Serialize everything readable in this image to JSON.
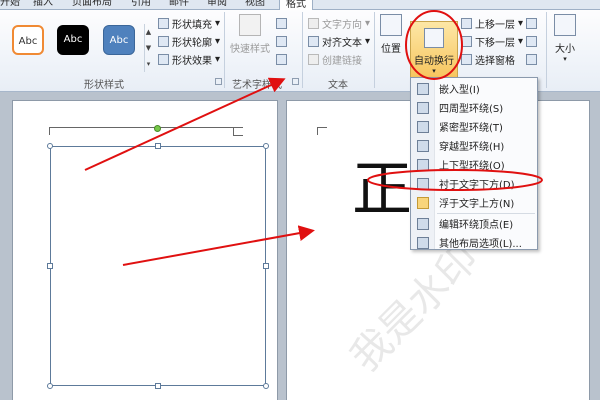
{
  "tabs": [
    "开始",
    "插入",
    "页面布局",
    "引用",
    "邮件",
    "审阅",
    "视图",
    "格式"
  ],
  "active_tab": "格式",
  "ribbon": {
    "shape_styles": {
      "swatches": [
        "Abc",
        "Abc",
        "Abc"
      ],
      "fill": "形状填充",
      "outline": "形状轮廓",
      "effect": "形状效果",
      "group_label": "形状样式"
    },
    "wordart": {
      "quick_styles": "快速样式",
      "group_label": "艺术字样式"
    },
    "text": {
      "direction": "文字方向",
      "align": "对齐文本",
      "link": "创建链接",
      "group_label": "文本"
    },
    "arrange": {
      "position": "位置",
      "wrap": "自动换行",
      "bring_forward": "上移一层",
      "send_backward": "下移一层",
      "selection_pane": "选择窗格"
    },
    "size": {
      "label": "大小"
    }
  },
  "wrap_menu": {
    "items": [
      "嵌入型(I)",
      "四周型环绕(S)",
      "紧密型环绕(T)",
      "穿越型环绕(H)",
      "上下型环绕(O)",
      "衬于文字下方(D)",
      "浮于文字上方(N)",
      "编辑环绕顶点(E)",
      "其他布局选项(L)..."
    ],
    "checked": "浮于文字上方(N)"
  },
  "document": {
    "page2_char": "正",
    "watermark": "我是水印"
  },
  "colors": {
    "annotation_red": "#e01010",
    "wrap_button_highlight": "#f7c45c",
    "menu_checked": "#f9d57b"
  }
}
